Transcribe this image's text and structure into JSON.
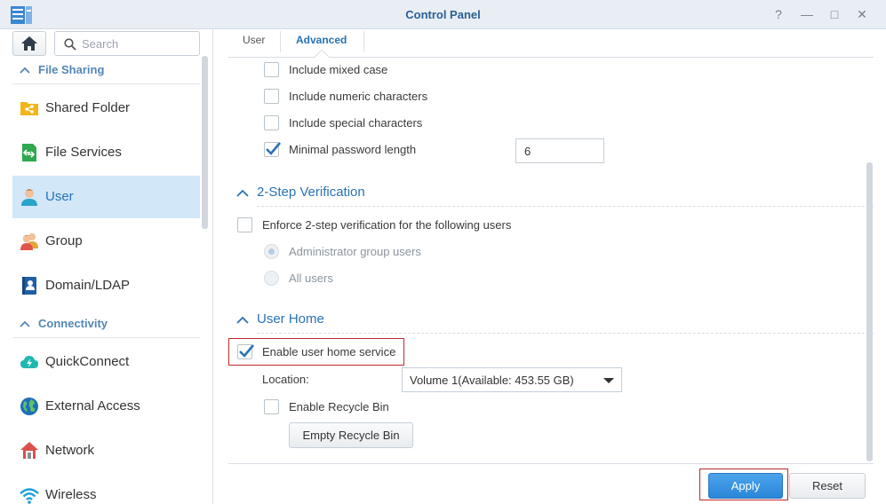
{
  "window": {
    "title": "Control Panel",
    "controls": {
      "help": "?",
      "minimize": "—",
      "maximize": "□",
      "close": "✕"
    }
  },
  "sidebar": {
    "search": {
      "placeholder": "Search"
    },
    "sections": [
      {
        "label": "File Sharing",
        "items": [
          {
            "label": "Shared Folder",
            "icon": "shared-folder-icon"
          },
          {
            "label": "File Services",
            "icon": "file-services-icon"
          },
          {
            "label": "User",
            "icon": "user-icon",
            "selected": true
          },
          {
            "label": "Group",
            "icon": "group-icon"
          },
          {
            "label": "Domain/LDAP",
            "icon": "domain-ldap-icon"
          }
        ]
      },
      {
        "label": "Connectivity",
        "items": [
          {
            "label": "QuickConnect",
            "icon": "quickconnect-icon"
          },
          {
            "label": "External Access",
            "icon": "external-access-icon"
          },
          {
            "label": "Network",
            "icon": "network-icon"
          },
          {
            "label": "Wireless",
            "icon": "wireless-icon"
          }
        ]
      }
    ]
  },
  "tabs": [
    {
      "label": "User",
      "active": false
    },
    {
      "label": "Advanced",
      "active": true
    }
  ],
  "password": {
    "mixed_case": {
      "label": "Include mixed case",
      "checked": false
    },
    "numeric": {
      "label": "Include numeric characters",
      "checked": false
    },
    "special": {
      "label": "Include special characters",
      "checked": false
    },
    "min_length": {
      "label": "Minimal password length",
      "checked": true,
      "value": "6"
    }
  },
  "two_step": {
    "title": "2-Step Verification",
    "enforce": {
      "label": "Enforce 2-step verification for the following users",
      "checked": false
    },
    "options": [
      {
        "label": "Administrator group users",
        "selected": true
      },
      {
        "label": "All users",
        "selected": false
      }
    ]
  },
  "user_home": {
    "title": "User Home",
    "enable": {
      "label": "Enable user home service",
      "checked": true
    },
    "location_label": "Location:",
    "location_value": "Volume 1(Available: 453.55 GB)",
    "recycle": {
      "label": "Enable Recycle Bin",
      "checked": false
    },
    "empty_button": "Empty Recycle Bin"
  },
  "footer": {
    "apply": "Apply",
    "reset": "Reset"
  },
  "colors": {
    "accent": "#2a72b5",
    "selected_bg": "#d2e7f8",
    "highlight": "#c1272d",
    "apply_button": "#2a86d8"
  }
}
